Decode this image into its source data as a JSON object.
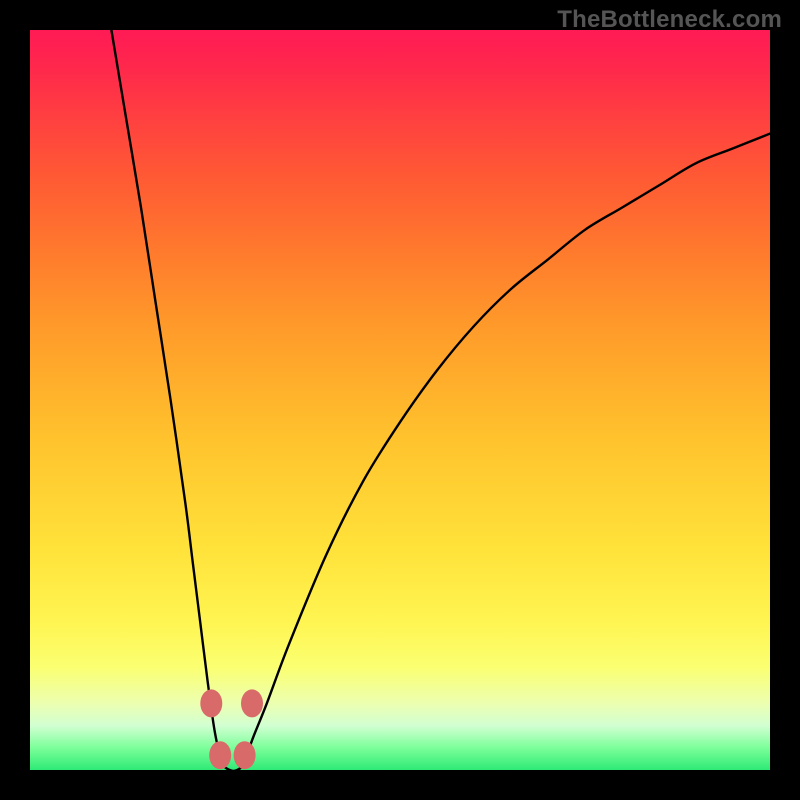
{
  "watermark": "TheBottleneck.com",
  "chart_data": {
    "type": "line",
    "title": "",
    "xlabel": "",
    "ylabel": "",
    "xlim": [
      0,
      100
    ],
    "ylim": [
      0,
      100
    ],
    "grid": false,
    "series": [
      {
        "name": "bottleneck-curve",
        "color": "#000000",
        "x": [
          11,
          13,
          15,
          17,
          19,
          21,
          22,
          23,
          24,
          25,
          26,
          27,
          28,
          29,
          30,
          32,
          35,
          40,
          45,
          50,
          55,
          60,
          65,
          70,
          75,
          80,
          85,
          90,
          95,
          100
        ],
        "values": [
          100,
          88,
          76,
          63,
          50,
          36,
          28,
          20,
          12,
          5,
          1,
          0,
          0,
          1,
          4,
          9,
          17,
          29,
          39,
          47,
          54,
          60,
          65,
          69,
          73,
          76,
          79,
          82,
          84,
          86
        ]
      }
    ],
    "markers": [
      {
        "x": 24.5,
        "y": 9,
        "color": "#d96a6a"
      },
      {
        "x": 30.0,
        "y": 9,
        "color": "#d96a6a"
      },
      {
        "x": 25.7,
        "y": 2,
        "color": "#d96a6a"
      },
      {
        "x": 29.0,
        "y": 2,
        "color": "#d96a6a"
      }
    ],
    "background_gradient": {
      "top": "#ff1a55",
      "mid": "#ffe23a",
      "bottom": "#2eea76"
    }
  }
}
